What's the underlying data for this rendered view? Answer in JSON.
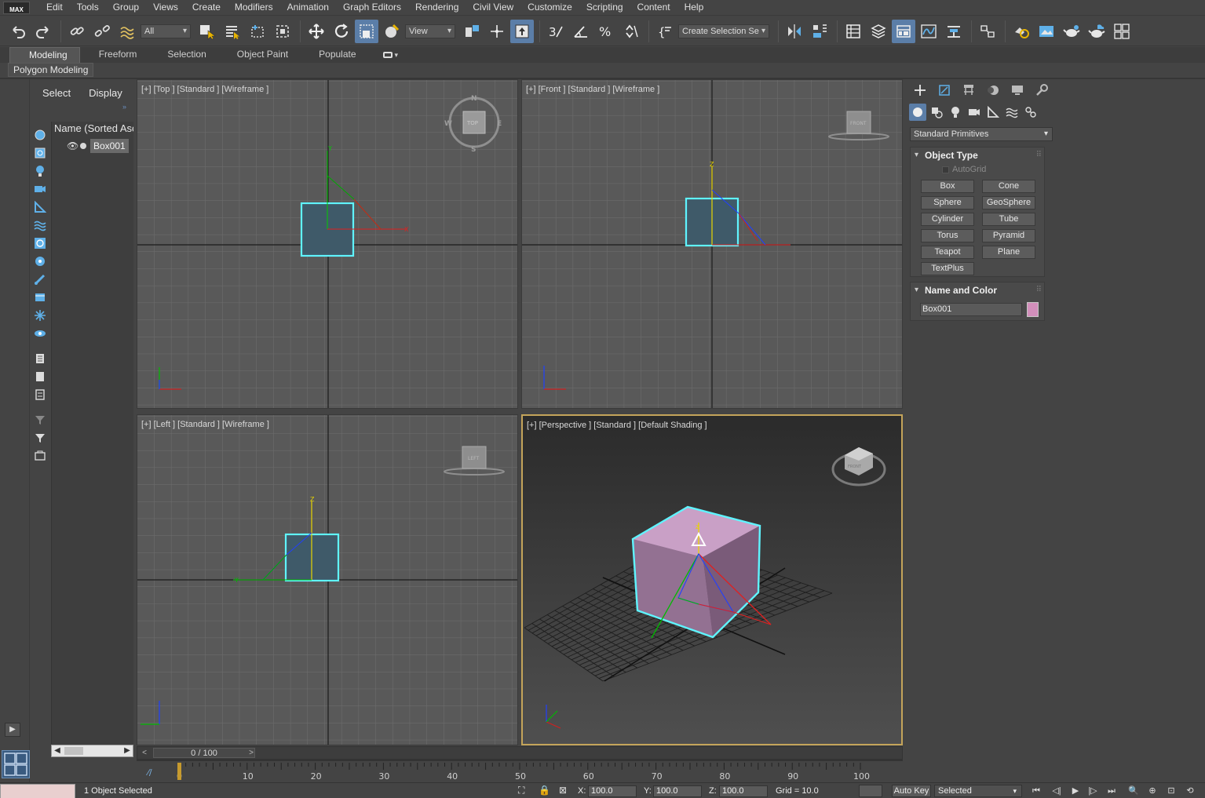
{
  "app": {
    "logo_text": "MAX"
  },
  "menubar": {
    "items": [
      "Edit",
      "Tools",
      "Group",
      "Views",
      "Create",
      "Modifiers",
      "Animation",
      "Graph Editors",
      "Rendering",
      "Civil View",
      "Customize",
      "Scripting",
      "Content",
      "Help"
    ]
  },
  "toolbar": {
    "filter_value": "All",
    "ref_coord_value": "View",
    "selection_set_placeholder": "Create Selection Se"
  },
  "ribbon": {
    "tabs": [
      "Modeling",
      "Freeform",
      "Selection",
      "Object Paint",
      "Populate"
    ],
    "active_tab": "Modeling",
    "sub_panel": "Polygon Modeling"
  },
  "scene_explorer": {
    "tabs": [
      "Select",
      "Display"
    ],
    "column_header": "Name (Sorted Asc",
    "items": [
      {
        "name": "Box001"
      }
    ]
  },
  "viewports": {
    "top": {
      "label": "[+] [Top ] [Standard ] [Wireframe ]",
      "cube_label": "TOP",
      "compass": [
        "N",
        "E",
        "S",
        "W"
      ]
    },
    "front": {
      "label": "[+] [Front ] [Standard ] [Wireframe ]",
      "cube_label": "FRONT"
    },
    "left": {
      "label": "[+] [Left ] [Standard ] [Wireframe ]",
      "cube_label": "LEFT"
    },
    "perspective": {
      "label": "[+] [Perspective ] [Standard ] [Default Shading ]",
      "cube_label": "FRONT"
    }
  },
  "command_panel": {
    "category": "Standard Primitives",
    "object_type": {
      "title": "Object Type",
      "autogrid_label": "AutoGrid",
      "buttons": [
        "Box",
        "Cone",
        "Sphere",
        "GeoSphere",
        "Cylinder",
        "Tube",
        "Torus",
        "Pyramid",
        "Teapot",
        "Plane",
        "TextPlus"
      ]
    },
    "name_and_color": {
      "title": "Name and Color",
      "name_value": "Box001",
      "color": "#d28fbb"
    }
  },
  "time_slider": {
    "frame_display": "0 / 100",
    "ticks": [
      "0",
      "10",
      "20",
      "30",
      "40",
      "50",
      "60",
      "70",
      "80",
      "90",
      "100"
    ]
  },
  "status_bar": {
    "selection_text": "1 Object Selected",
    "x_label": "X:",
    "x_value": "100.0",
    "y_label": "Y:",
    "y_value": "100.0",
    "z_label": "Z:",
    "z_value": "100.0",
    "grid_text": "Grid = 10.0",
    "autokey_label": "Auto Key",
    "key_filter_value": "Selected"
  },
  "colors": {
    "accent_active": "#5b7ea8",
    "selection_outline": "#5ff4ff",
    "box_color": "#d28fbb",
    "active_viewport_border": "#c4a45a"
  }
}
